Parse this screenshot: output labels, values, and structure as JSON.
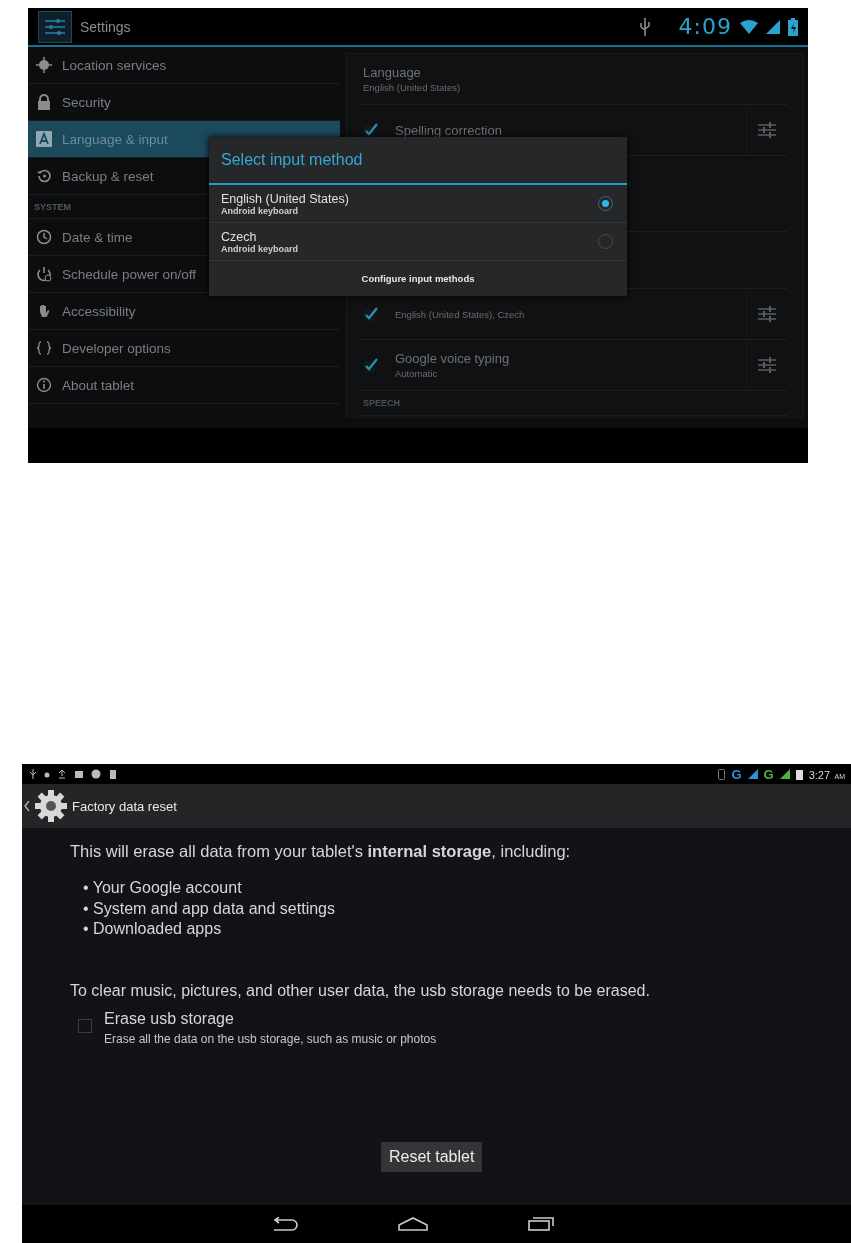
{
  "settings_screen": {
    "status_bar": {
      "title": "Settings",
      "time": "4:09"
    },
    "sidebar": {
      "items": [
        {
          "kind": "item",
          "label": "Location services",
          "selected": false
        },
        {
          "kind": "item",
          "label": "Security",
          "selected": false
        },
        {
          "kind": "item",
          "label": "Language & input",
          "selected": true
        },
        {
          "kind": "item",
          "label": "Backup & reset",
          "selected": false
        },
        {
          "kind": "header",
          "label": "SYSTEM"
        },
        {
          "kind": "item",
          "label": "Date & time",
          "selected": false
        },
        {
          "kind": "item",
          "label": "Schedule power on/off",
          "selected": false
        },
        {
          "kind": "item",
          "label": "Accessibility",
          "selected": false
        },
        {
          "kind": "item",
          "label": "Developer options",
          "selected": false
        },
        {
          "kind": "item",
          "label": "About tablet",
          "selected": false
        }
      ]
    },
    "detail": {
      "items": [
        {
          "kind": "setting",
          "title": "Language",
          "subtitle": "English (United States)"
        },
        {
          "kind": "check",
          "title": "Spelling correction",
          "checked": true
        },
        {
          "kind": "gap"
        },
        {
          "kind": "check",
          "subtitle": "English (United States), Czech",
          "checked": true
        },
        {
          "kind": "check",
          "title": "Google voice typing",
          "subtitle": "Automatic",
          "checked": true
        },
        {
          "kind": "header",
          "title": "SPEECH"
        }
      ]
    },
    "dialog": {
      "title": "Select input method",
      "options": [
        {
          "label": "English (United States)",
          "sublabel": "Android keyboard",
          "selected": true
        },
        {
          "label": "Czech",
          "sublabel": "Android keyboard",
          "selected": false
        }
      ],
      "footer": "Configure input methods"
    }
  },
  "factory_reset_screen": {
    "status_bar": {
      "networks": [
        {
          "label": "G",
          "color": "#2f8fd8"
        },
        {
          "label": "G",
          "color": "#52b043"
        }
      ],
      "time": "3:27",
      "meridiem": "AM"
    },
    "header": {
      "title": "Factory data reset"
    },
    "intro": "This will erase all data from your tablet's **internal storage**, including:",
    "bullets": [
      "• Your Google account",
      "• System and app data and settings",
      "• Downloaded apps"
    ],
    "note": "To clear music, pictures, and other user data, the usb storage needs to be erased.",
    "option": {
      "title": "Erase usb storage",
      "description": "Erase all the data on the usb storage, such as music or photos",
      "checked": false
    },
    "button": "Reset tablet"
  }
}
